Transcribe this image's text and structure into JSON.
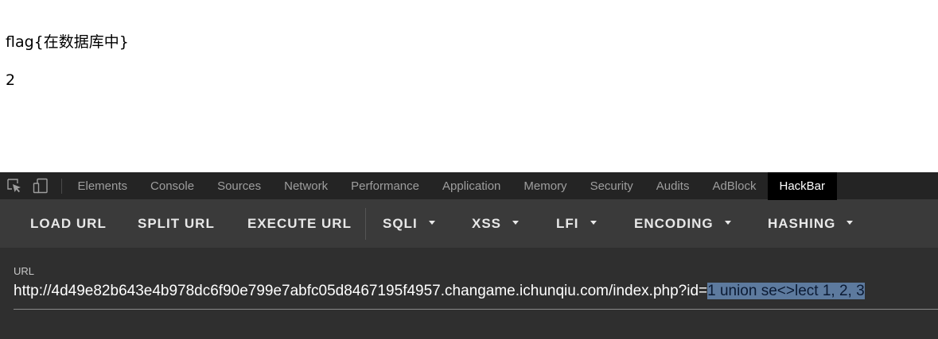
{
  "page": {
    "line1": "flag{在数据库中}",
    "line2": "2"
  },
  "devtools": {
    "icons": [
      "inspect-element-icon",
      "device-toggle-icon"
    ],
    "tabs": [
      {
        "label": "Elements"
      },
      {
        "label": "Console"
      },
      {
        "label": "Sources"
      },
      {
        "label": "Network"
      },
      {
        "label": "Performance"
      },
      {
        "label": "Application"
      },
      {
        "label": "Memory"
      },
      {
        "label": "Security"
      },
      {
        "label": "Audits"
      },
      {
        "label": "AdBlock"
      },
      {
        "label": "HackBar"
      }
    ],
    "active_tab": "HackBar"
  },
  "hackbar": {
    "buttons": {
      "load_url": "LOAD URL",
      "split_url": "SPLIT URL",
      "execute_url": "EXECUTE URL",
      "sqli": "SQLI",
      "xss": "XSS",
      "lfi": "LFI",
      "encoding": "ENCODING",
      "hashing": "HASHING"
    },
    "url_label": "URL",
    "url_base": "http://4d49e82b643e4b978dc6f90e799e7abfc05d8467195f4957.changame.ichunqiu.com/index.php?id=",
    "url_selected": "1 union se<>lect 1, 2, 3"
  },
  "colors": {
    "devtools_bg": "#242424",
    "toolbar_bg": "#3a3a3a",
    "panel_bg": "#2f2f2f",
    "active_tab_bg": "#000000",
    "selection": "#5d7a9e"
  }
}
